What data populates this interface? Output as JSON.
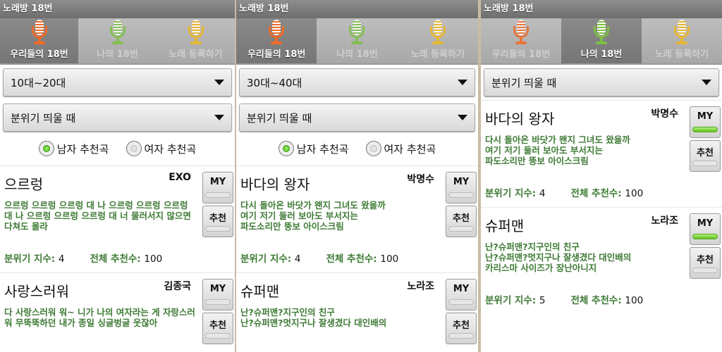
{
  "colors": {
    "tab1": "#f06a28",
    "tab2": "#7cc043",
    "tab3": "#f0b820",
    "lyrics": "#3d7a34"
  },
  "panels": [
    {
      "app_title": "노래방 18번",
      "tabs": [
        {
          "label": "우리들의 18번",
          "active": true
        },
        {
          "label": "나의 18번",
          "active": false
        },
        {
          "label": "노래 등록하기",
          "active": false
        }
      ],
      "dropdowns": [
        "10대~20대",
        "분위기 띄울 때"
      ],
      "radios": [
        {
          "label": "남자 추천곡",
          "checked": true
        },
        {
          "label": "여자 추천곡",
          "checked": false
        }
      ],
      "items": [
        {
          "title": "으르렁",
          "artist": "EXO",
          "lyrics": "으르렁 으르렁 으르렁 대 나 으르렁 으르렁 으르렁 대 나 으르렁 으르렁 으르렁 대 너 물러서지 않으면 다쳐도 몰라",
          "mood_label": "분위기 지수:",
          "mood": "4",
          "total_label": "전체 추천수:",
          "total": "100",
          "my_label": "MY",
          "my_on": false,
          "rec_label": "추천"
        },
        {
          "title": "사랑스러워",
          "artist": "김종국",
          "lyrics": "다 사랑스러워 워~ 니가 나의 여자라는 게 자랑스러워 무뚝뚝하던 내가 종일 싱글벙글 웃잖아",
          "my_label": "MY",
          "my_on": false,
          "rec_label": "추천"
        }
      ]
    },
    {
      "app_title": "노래방 18번",
      "tabs": [
        {
          "label": "우리들의 18번",
          "active": true
        },
        {
          "label": "나의 18번",
          "active": false
        },
        {
          "label": "노래 등록하기",
          "active": false
        }
      ],
      "dropdowns": [
        "30대~40대",
        "분위기 띄울 때"
      ],
      "radios": [
        {
          "label": "남자 추천곡",
          "checked": true
        },
        {
          "label": "여자 추천곡",
          "checked": false
        }
      ],
      "items": [
        {
          "title": "바다의 왕자",
          "artist": "박명수",
          "lyrics": "다시 돌아온 바닷가 왠지 그녀도 왔을까\n여기 저기 둘러 보아도 부서지는\n파도소리만 뚱보 아이스크림",
          "mood_label": "분위기 지수:",
          "mood": "4",
          "total_label": "전체 추천수:",
          "total": "100",
          "my_label": "MY",
          "my_on": false,
          "rec_label": "추천"
        },
        {
          "title": "슈퍼맨",
          "artist": "노라조",
          "lyrics": "난?슈퍼맨?지구인의 친구\n난?슈퍼맨?멋지구나 잘생겼다 대인배의",
          "my_label": "MY",
          "my_on": false,
          "rec_label": "추천"
        }
      ]
    },
    {
      "app_title": "노래방 18번",
      "tabs": [
        {
          "label": "우리들의 18번",
          "active": false
        },
        {
          "label": "나의 18번",
          "active": true
        },
        {
          "label": "노래 등록하기",
          "active": false
        }
      ],
      "dropdowns": [
        "분위기 띄울 때"
      ],
      "radios": [],
      "items": [
        {
          "title": "바다의 왕자",
          "artist": "박명수",
          "lyrics": "다시 돌아온 바닷가 왠지 그녀도 왔을까\n여기 저기 둘러 보아도 부서지는\n파도소리만 뚱보 아이스크림",
          "mood_label": "분위기 지수:",
          "mood": "4",
          "total_label": "전체 추천수:",
          "total": "100",
          "my_label": "MY",
          "my_on": true,
          "rec_label": "추천"
        },
        {
          "title": "슈퍼맨",
          "artist": "노라조",
          "lyrics": "난?슈퍼맨?지구인의 친구\n난?슈퍼맨?멋지구나 잘생겼다 대인배의\n카리스마 사이즈가 장난아니지",
          "mood_label": "분위기 지수:",
          "mood": "5",
          "total_label": "전체 추천수:",
          "total": "100",
          "my_label": "MY",
          "my_on": true,
          "rec_label": "추천"
        }
      ]
    }
  ]
}
